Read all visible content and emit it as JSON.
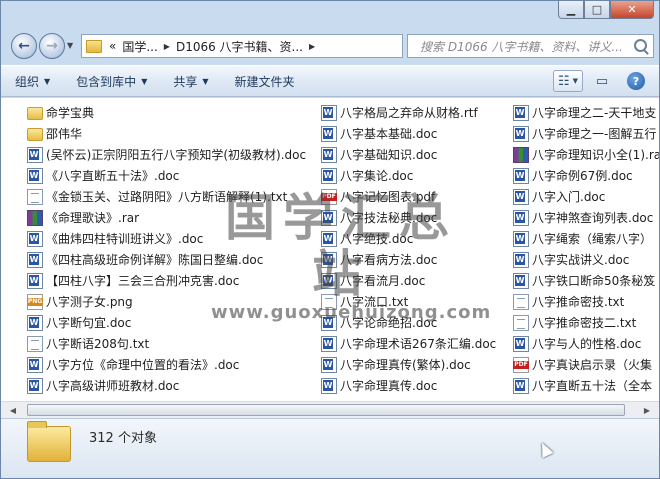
{
  "window": {
    "min_icon": "minimize-icon",
    "max_icon": "maximize-icon",
    "close_icon": "close-icon"
  },
  "nav": {
    "address": {
      "prefix": "«",
      "crumbs": [
        "国学...",
        "D1066 八字书籍、资..."
      ]
    },
    "search_placeholder": "搜索 D1066 八字书籍、资料、讲义..."
  },
  "toolbar": {
    "organize": "组织",
    "include_library": "包含到库中",
    "share": "共享",
    "new_folder": "新建文件夹"
  },
  "files": {
    "col1": [
      {
        "name": "命学宝典",
        "type": "folder"
      },
      {
        "name": "邵伟华",
        "type": "folder"
      },
      {
        "name": "(吴怀云)正宗阴阳五行八字预知学(初级教材).doc",
        "type": "doc"
      },
      {
        "name": "《八字直断五十法》.doc",
        "type": "doc"
      },
      {
        "name": "《金锁玉关、过路阴阳》八方断语解释(1).txt",
        "type": "txt"
      },
      {
        "name": "《命理歌诀》.rar",
        "type": "rar"
      },
      {
        "name": "《曲炜四柱特训班讲义》.doc",
        "type": "doc"
      },
      {
        "name": "《四柱高级班命例详解》陈国日整编.doc",
        "type": "doc"
      },
      {
        "name": "【四柱八字】三会三合刑冲克害.doc",
        "type": "doc"
      },
      {
        "name": "八字测子女.png",
        "type": "png"
      },
      {
        "name": "八字断句宜.doc",
        "type": "doc"
      },
      {
        "name": "八字断语208句.txt",
        "type": "txt"
      },
      {
        "name": "八字方位《命理中位置的看法》.doc",
        "type": "doc"
      },
      {
        "name": "八字高级讲师班教材.doc",
        "type": "doc"
      }
    ],
    "col2": [
      {
        "name": "八字格局之弃命从财格.rtf",
        "type": "doc"
      },
      {
        "name": "八字基本基础.doc",
        "type": "doc"
      },
      {
        "name": "八字基础知识.doc",
        "type": "doc"
      },
      {
        "name": "八字集论.doc",
        "type": "doc"
      },
      {
        "name": "八字记忆图表.pdf",
        "type": "pdf"
      },
      {
        "name": "八字技法秘典.doc",
        "type": "doc"
      },
      {
        "name": "八字绝技.doc",
        "type": "doc"
      },
      {
        "name": "八字看病方法.doc",
        "type": "doc"
      },
      {
        "name": "八字看流月.doc",
        "type": "doc"
      },
      {
        "name": "八字流口.txt",
        "type": "txt"
      },
      {
        "name": "八字论命绝招.doc",
        "type": "doc"
      },
      {
        "name": "八字命理术语267条汇编.doc",
        "type": "doc"
      },
      {
        "name": "八字命理真传(繁体).doc",
        "type": "doc"
      },
      {
        "name": "八字命理真传.doc",
        "type": "doc"
      }
    ],
    "col3": [
      {
        "name": "八字命理之二-天干地支",
        "type": "doc"
      },
      {
        "name": "八字命理之一-图解五行",
        "type": "doc"
      },
      {
        "name": "八字命理知识小全(1).ra",
        "type": "rar"
      },
      {
        "name": "八字命例67例.doc",
        "type": "doc"
      },
      {
        "name": "八字入门.doc",
        "type": "doc"
      },
      {
        "name": "八字神煞查询列表.doc",
        "type": "doc"
      },
      {
        "name": "八字绳索（绳索八字）",
        "type": "doc"
      },
      {
        "name": "八字实战讲义.doc",
        "type": "doc"
      },
      {
        "name": "八字铁口断命50条秘笈",
        "type": "doc"
      },
      {
        "name": "八字推命密技.txt",
        "type": "txt"
      },
      {
        "name": "八字推命密技二.txt",
        "type": "txt"
      },
      {
        "name": "八字与人的性格.doc",
        "type": "doc"
      },
      {
        "name": "八字真诀启示录（火集",
        "type": "pdf"
      },
      {
        "name": "八字直断五十法（全本",
        "type": "doc"
      }
    ]
  },
  "watermark": {
    "title": "国学汇总站",
    "url": "www.guoxuehuizong.com"
  },
  "status": {
    "count": "312 个对象"
  }
}
